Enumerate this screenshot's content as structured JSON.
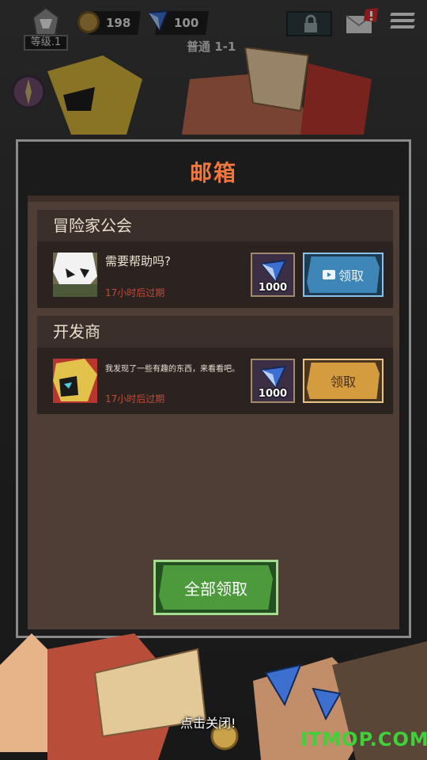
{
  "hud": {
    "level": "等级.1",
    "coins": "198",
    "gems": "100",
    "stage": "普通 1-1"
  },
  "mailbox": {
    "title": "邮箱",
    "mails": [
      {
        "sender": "冒险家公会",
        "message": "需要帮助吗?",
        "expire": "17小时后过期",
        "reward_value": "1000",
        "claim_label": "领取",
        "claim_style": "video"
      },
      {
        "sender": "开发商",
        "message": "我发现了一些有趣的东西，来看看吧。",
        "expire": "17小时后过期",
        "reward_value": "1000",
        "claim_label": "领取",
        "claim_style": "gold"
      }
    ],
    "collect_all_label": "全部领取",
    "close_hint": "点击关闭!"
  },
  "watermark": "ITMOP.COM",
  "colors": {
    "title_orange": "#f0763c",
    "expire_red": "#c24a39",
    "claim_blue": "#3f86b8",
    "claim_gold": "#d59c3f",
    "collect_green": "#4c9a3c"
  },
  "icons": [
    "level-emblem-icon",
    "coin-icon",
    "gem-icon",
    "lock-icon",
    "mail-icon",
    "alert-icon",
    "menu-icon",
    "video-icon"
  ]
}
